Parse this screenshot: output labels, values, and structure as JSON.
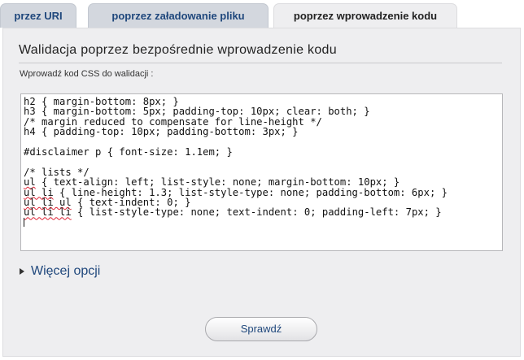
{
  "tabs": [
    {
      "label": "przez URI"
    },
    {
      "label": "poprzez załadowanie pliku"
    },
    {
      "label": "poprzez wprowadzenie kodu"
    }
  ],
  "panel": {
    "title": "Walidacja poprzez bezpośrednie wprowadzenie kodu",
    "field_label": "Wprowadź kod CSS do walidacji :",
    "code_lines": [
      "h2 { margin-bottom: 8px; }",
      "h3 { margin-bottom: 5px; padding-top: 10px; clear: both; }",
      "/* margin reduced to compensate for line-height */",
      "h4 { padding-top: 10px; padding-bottom: 3px; }",
      "",
      "#disclaimer p { font-size: 1.1em; }",
      "",
      "/* lists */",
      "ul { text-align: left; list-style: none; margin-bottom: 10px; }",
      "ul li { line-height: 1.3; list-style-type: none; padding-bottom: 6px; }",
      "ul li ul { text-indent: 0; }",
      "ul li li { list-style-type: none; text-indent: 0; padding-left: 7px; }"
    ],
    "more_options": "Więcej opcji",
    "submit_label": "Sprawdź"
  }
}
